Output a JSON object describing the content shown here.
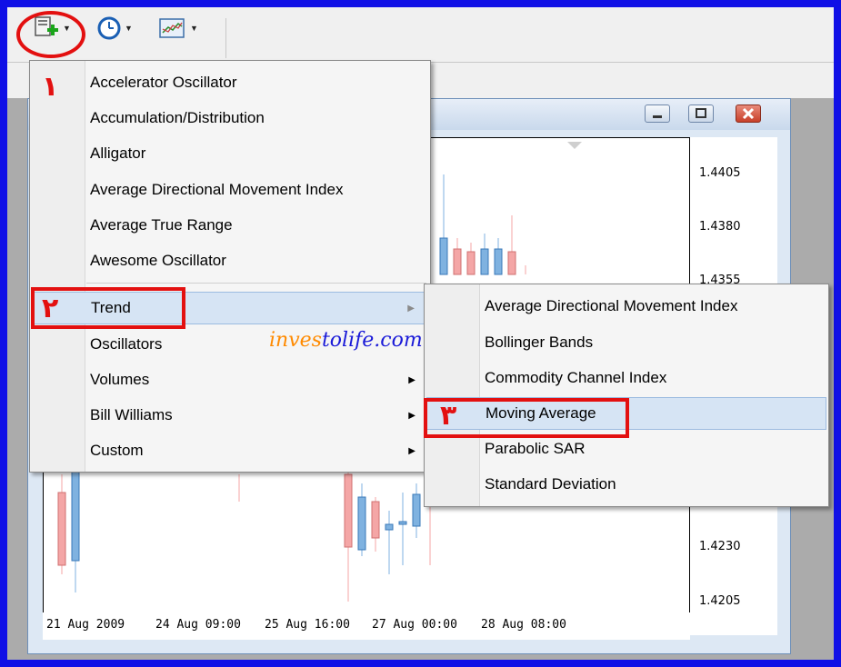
{
  "toolbar": {
    "icons": [
      "add-indicator-icon",
      "clock-icon",
      "chart-template-icon"
    ]
  },
  "indicators_menu": {
    "items": [
      {
        "label": "Accelerator Oscillator"
      },
      {
        "label": "Accumulation/Distribution"
      },
      {
        "label": "Alligator"
      },
      {
        "label": "Average Directional Movement Index"
      },
      {
        "label": "Average True Range"
      },
      {
        "label": "Awesome Oscillator"
      },
      {
        "label": "Trend",
        "submenu": true,
        "highlighted": true
      },
      {
        "label": "Oscillators",
        "submenu": true
      },
      {
        "label": "Volumes",
        "submenu": true
      },
      {
        "label": "Bill Williams",
        "submenu": true
      },
      {
        "label": "Custom",
        "submenu": true
      }
    ]
  },
  "trend_submenu": {
    "items": [
      {
        "label": "Average Directional Movement Index"
      },
      {
        "label": "Bollinger Bands"
      },
      {
        "label": "Commodity Channel Index"
      },
      {
        "label": "Moving Average",
        "highlighted": true
      },
      {
        "label": "Parabolic SAR"
      },
      {
        "label": "Standard Deviation"
      }
    ]
  },
  "annotations": {
    "step1": "١",
    "step2": "٢",
    "step3": "٣"
  },
  "watermark": {
    "part1": "inves",
    "part2": "tolife",
    "part3": ".com"
  },
  "chart": {
    "price_labels": [
      "1.4405",
      "1.4380",
      "1.4355",
      "1.4230",
      "1.4205"
    ],
    "time_labels": [
      "21 Aug 2009",
      "24 Aug 09:00",
      "25 Aug 16:00",
      "27 Aug 00:00",
      "28 Aug 08:00"
    ]
  },
  "colors": {
    "frame": "#1010e6",
    "annotation": "#e31010",
    "bull_candle": "#7fb2e0",
    "bear_candle": "#f4a6a6"
  }
}
